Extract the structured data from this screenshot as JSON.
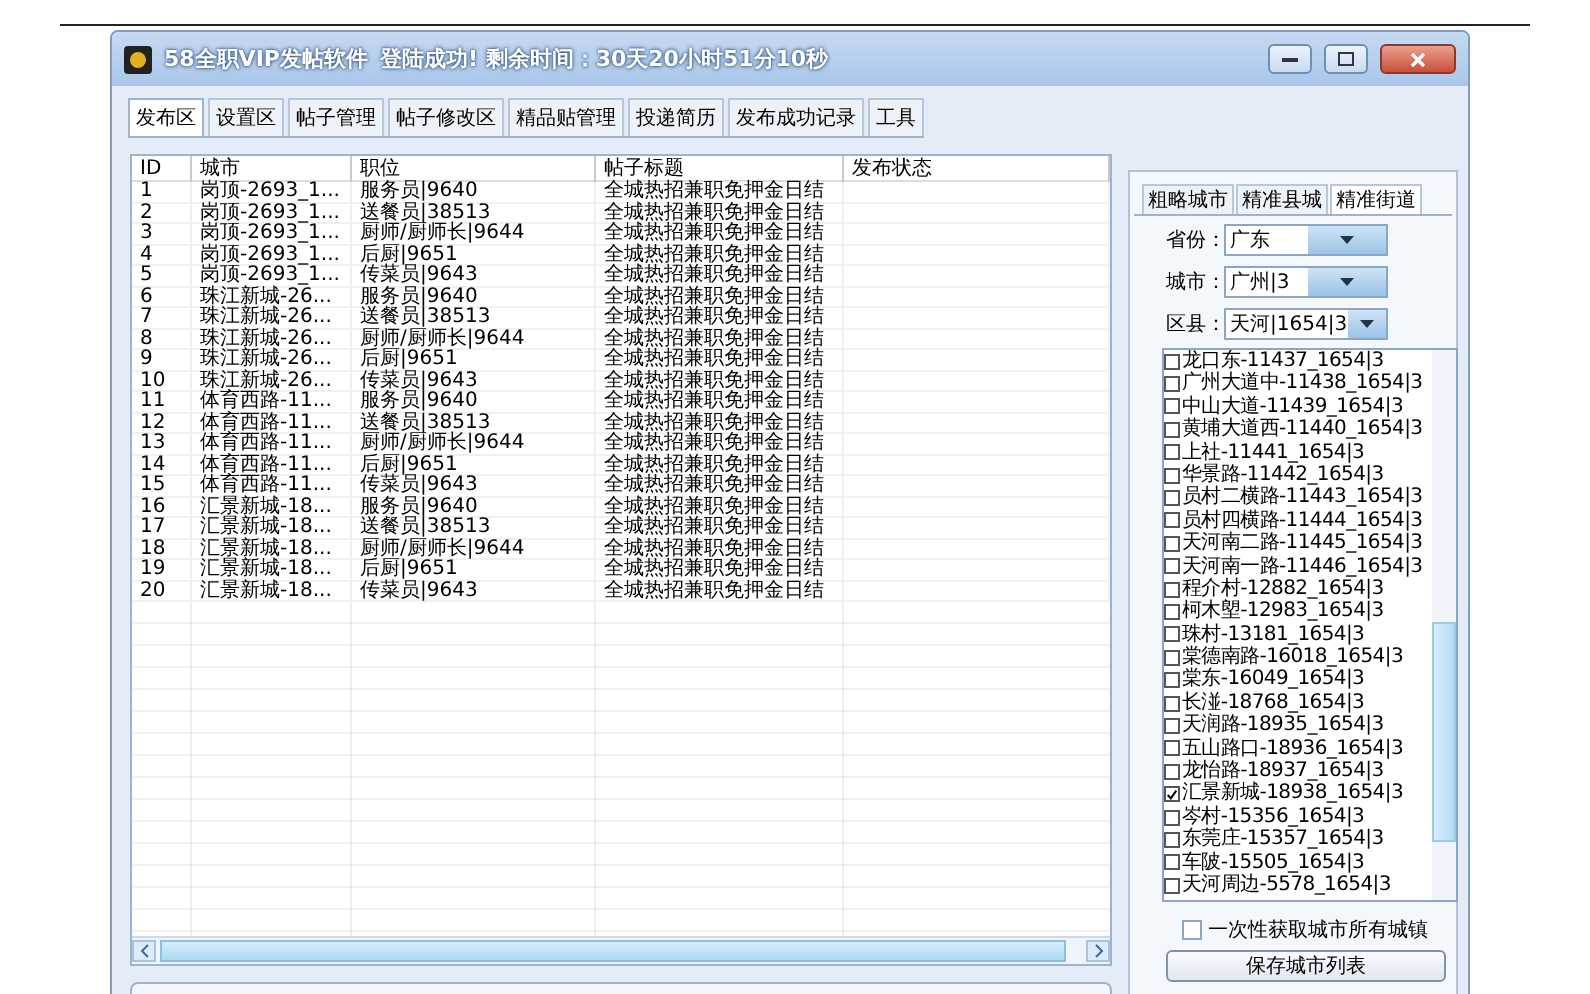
{
  "window": {
    "title": "58全职VIP发帖软件",
    "status": "登陆成功! 剩余时间：30天20小时51分10秒"
  },
  "tabs": [
    {
      "label": "发布区",
      "selected": true
    },
    {
      "label": "设置区",
      "selected": false
    },
    {
      "label": "帖子管理",
      "selected": false
    },
    {
      "label": "帖子修改区",
      "selected": false
    },
    {
      "label": "精品贴管理",
      "selected": false
    },
    {
      "label": "投递简历",
      "selected": false
    },
    {
      "label": "发布成功记录",
      "selected": false
    },
    {
      "label": "工具",
      "selected": false
    }
  ],
  "table": {
    "columns": [
      "ID",
      "城市",
      "职位",
      "帖子标题",
      "发布状态"
    ],
    "rows": [
      [
        "1",
        "岗顶-2693_1...",
        "服务员|9640",
        "全城热招兼职免押金日结"
      ],
      [
        "2",
        "岗顶-2693_1...",
        "送餐员|38513",
        "全城热招兼职免押金日结"
      ],
      [
        "3",
        "岗顶-2693_1...",
        "厨师/厨师长|9644",
        "全城热招兼职免押金日结"
      ],
      [
        "4",
        "岗顶-2693_1...",
        "后厨|9651",
        "全城热招兼职免押金日结"
      ],
      [
        "5",
        "岗顶-2693_1...",
        "传菜员|9643",
        "全城热招兼职免押金日结"
      ],
      [
        "6",
        "珠江新城-26...",
        "服务员|9640",
        "全城热招兼职免押金日结"
      ],
      [
        "7",
        "珠江新城-26...",
        "送餐员|38513",
        "全城热招兼职免押金日结"
      ],
      [
        "8",
        "珠江新城-26...",
        "厨师/厨师长|9644",
        "全城热招兼职免押金日结"
      ],
      [
        "9",
        "珠江新城-26...",
        "后厨|9651",
        "全城热招兼职免押金日结"
      ],
      [
        "10",
        "珠江新城-26...",
        "传菜员|9643",
        "全城热招兼职免押金日结"
      ],
      [
        "11",
        "体育西路-11...",
        "服务员|9640",
        "全城热招兼职免押金日结"
      ],
      [
        "12",
        "体育西路-11...",
        "送餐员|38513",
        "全城热招兼职免押金日结"
      ],
      [
        "13",
        "体育西路-11...",
        "厨师/厨师长|9644",
        "全城热招兼职免押金日结"
      ],
      [
        "14",
        "体育西路-11...",
        "后厨|9651",
        "全城热招兼职免押金日结"
      ],
      [
        "15",
        "体育西路-11...",
        "传菜员|9643",
        "全城热招兼职免押金日结"
      ],
      [
        "16",
        "汇景新城-18...",
        "服务员|9640",
        "全城热招兼职免押金日结"
      ],
      [
        "17",
        "汇景新城-18...",
        "送餐员|38513",
        "全城热招兼职免押金日结"
      ],
      [
        "18",
        "汇景新城-18...",
        "厨师/厨师长|9644",
        "全城热招兼职免押金日结"
      ],
      [
        "19",
        "汇景新城-18...",
        "后厨|9651",
        "全城热招兼职免押金日结"
      ],
      [
        "20",
        "汇景新城-18...",
        "传菜员|9643",
        "全城热招兼职免押金日结"
      ]
    ]
  },
  "location_panel": {
    "tabs": [
      {
        "label": "粗略城市",
        "selected": false
      },
      {
        "label": "精准县城",
        "selected": false
      },
      {
        "label": "精准街道",
        "selected": true
      }
    ],
    "fields": [
      {
        "label": "省份：",
        "value": "广东"
      },
      {
        "label": "城市：",
        "value": "广州|3"
      },
      {
        "label": "区县：",
        "value": "天河|1654|3"
      }
    ],
    "streets": [
      {
        "label": "龙口东-11437_1654|3",
        "checked": false
      },
      {
        "label": "广州大道中-11438_1654|3",
        "checked": false
      },
      {
        "label": "中山大道-11439_1654|3",
        "checked": false
      },
      {
        "label": "黄埔大道西-11440_1654|3",
        "checked": false
      },
      {
        "label": "上社-11441_1654|3",
        "checked": false
      },
      {
        "label": "华景路-11442_1654|3",
        "checked": false
      },
      {
        "label": "员村二横路-11443_1654|3",
        "checked": false
      },
      {
        "label": "员村四横路-11444_1654|3",
        "checked": false
      },
      {
        "label": "天河南二路-11445_1654|3",
        "checked": false
      },
      {
        "label": "天河南一路-11446_1654|3",
        "checked": false
      },
      {
        "label": "程介村-12882_1654|3",
        "checked": false
      },
      {
        "label": "柯木塱-12983_1654|3",
        "checked": false
      },
      {
        "label": "珠村-13181_1654|3",
        "checked": false
      },
      {
        "label": "棠德南路-16018_1654|3",
        "checked": false
      },
      {
        "label": "棠东-16049_1654|3",
        "checked": false
      },
      {
        "label": "长湴-18768_1654|3",
        "checked": false
      },
      {
        "label": "天润路-18935_1654|3",
        "checked": false
      },
      {
        "label": "五山路口-18936_1654|3",
        "checked": false
      },
      {
        "label": "龙怡路-18937_1654|3",
        "checked": false
      },
      {
        "label": "汇景新城-18938_1654|3",
        "checked": true
      },
      {
        "label": "岑村-15356_1654|3",
        "checked": false
      },
      {
        "label": "东莞庄-15357_1654|3",
        "checked": false
      },
      {
        "label": "车陂-15505_1654|3",
        "checked": false
      },
      {
        "label": "天河周边-5578_1654|3",
        "checked": false
      }
    ],
    "fetch_all": {
      "label": "一次性获取城市所有城镇",
      "checked": false
    },
    "save_button": "保存城市列表"
  }
}
